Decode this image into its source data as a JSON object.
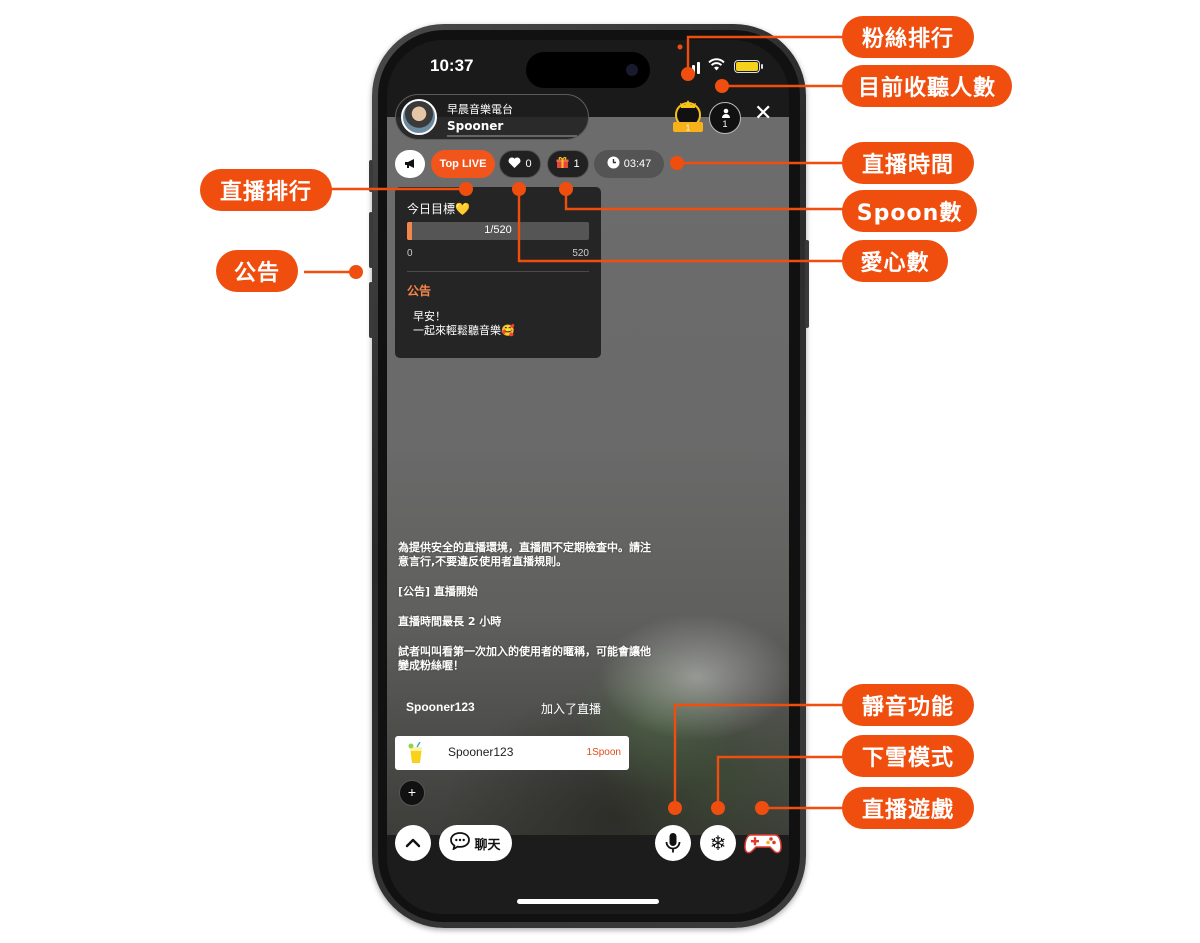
{
  "status_bar": {
    "time": "10:37"
  },
  "host": {
    "channel_name": "早晨音樂電台",
    "name": "Spooner"
  },
  "fan_rank": {
    "rank": "1"
  },
  "listeners": {
    "count": "1"
  },
  "close_label": "✕",
  "pills": {
    "top_live": "Top LIVE",
    "hearts": "0",
    "spoons": "1",
    "time": "03:47"
  },
  "goal": {
    "title": "今日目標💛",
    "progress_text": "1/520",
    "min": "0",
    "max": "520",
    "current": 1,
    "target": 520
  },
  "notice": {
    "title": "公告",
    "line1": "早安！",
    "line2": "一起來輕鬆聽音樂🥰"
  },
  "chat": {
    "system_line1": "為提供安全的直播環境，直播間不定期檢查中。請注",
    "system_line2": "意言行,不要違反使用者直播規則。",
    "announce": "[公告] 直播開始",
    "duration": "直播時間最長  2 小時",
    "tip_line1": "試者叫叫看第一次加入的使用者的暱稱，可能會讓他",
    "tip_line2": "變成粉絲喔！",
    "join_name": "Spooner123",
    "join_text": "加入了直播"
  },
  "donation": {
    "name": "Spooner123",
    "amount": "1Spoon"
  },
  "bottom_bar": {
    "chat_label": "聊天",
    "plus": "+"
  },
  "callouts": {
    "fan_rank": "粉絲排行",
    "listener_count": "目前收聽人數",
    "live_time": "直播時間",
    "live_rank": "直播排行",
    "spoon_count": "Spoon數",
    "notice": "公告",
    "heart_count": "愛心數",
    "mute": "靜音功能",
    "snow_mode": "下雪模式",
    "live_game": "直播遊戲"
  },
  "colors": {
    "accent": "#f04e0f",
    "top_live": "#f2551c",
    "goal_fill": "#f4864a",
    "battery": "#f7d21a"
  }
}
